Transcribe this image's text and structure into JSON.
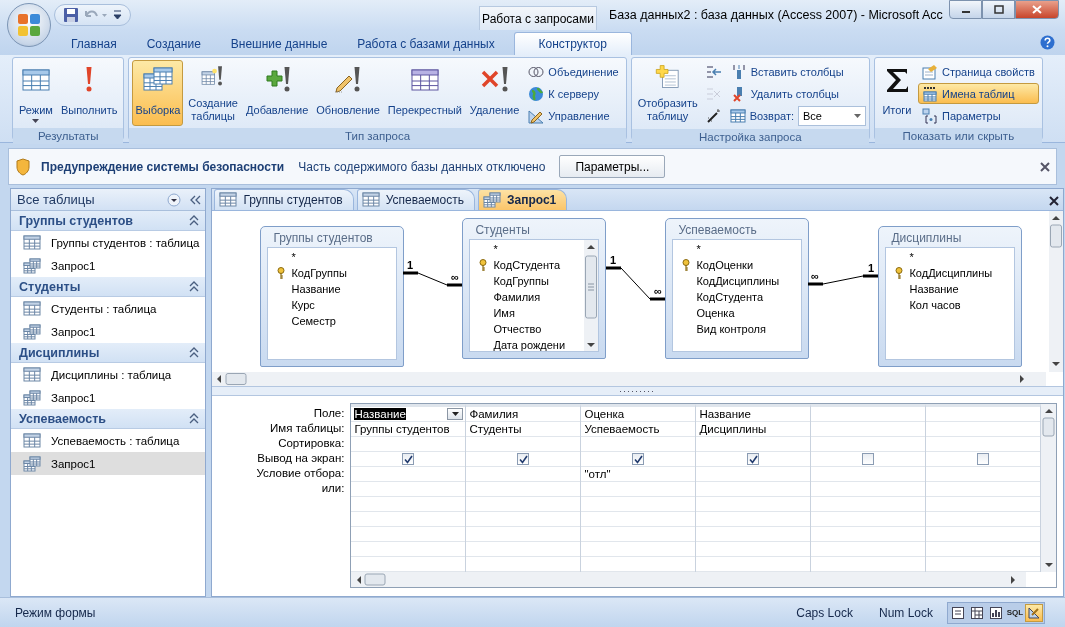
{
  "title_bar": {
    "context_tab": "Работа с запросами",
    "title": "База данных2 : база данных (Access 2007)  -  Microsoft Acc"
  },
  "ribbon_tabs": [
    {
      "label": "Главная",
      "selected": false
    },
    {
      "label": "Создание",
      "selected": false
    },
    {
      "label": "Внешние данные",
      "selected": false
    },
    {
      "label": "Работа с базами данных",
      "selected": false
    },
    {
      "label": "Конструктор",
      "selected": true
    }
  ],
  "ribbon_groups": [
    {
      "title": "Результаты",
      "items": [
        {
          "kind": "large",
          "label": "Режим",
          "dropdown": true,
          "selected": false
        },
        {
          "kind": "large",
          "label": "Выполнить",
          "dropdown": false,
          "selected": false
        }
      ]
    },
    {
      "title": "Тип запроса",
      "items": [
        {
          "kind": "large",
          "label": "Выборка",
          "dropdown": false,
          "selected": true
        },
        {
          "kind": "large",
          "label": "Создание таблицы",
          "dropdown": false,
          "selected": false
        },
        {
          "kind": "large",
          "label": "Добавление",
          "dropdown": false,
          "selected": false
        },
        {
          "kind": "large",
          "label": "Обновление",
          "dropdown": false,
          "selected": false
        },
        {
          "kind": "large",
          "label": "Перекрестный",
          "dropdown": false,
          "selected": false
        },
        {
          "kind": "large",
          "label": "Удаление",
          "dropdown": false,
          "selected": false
        },
        {
          "kind": "stack",
          "items": [
            {
              "kind": "small",
              "label": "Объединение",
              "selected": false
            },
            {
              "kind": "small",
              "label": "К серверу",
              "selected": false
            },
            {
              "kind": "small",
              "label": "Управление",
              "selected": false
            }
          ]
        }
      ]
    },
    {
      "title": "Настройка запроса",
      "items": [
        {
          "kind": "large",
          "label": "Отобразить таблицу",
          "dropdown": false,
          "selected": false
        },
        {
          "kind": "stack",
          "items": [
            {
              "kind": "icon",
              "disabled": false
            },
            {
              "kind": "icon",
              "disabled": true
            },
            {
              "kind": "icon",
              "disabled": false
            }
          ]
        },
        {
          "kind": "stack",
          "items": [
            {
              "kind": "small",
              "label": "Вставить столбцы",
              "selected": false
            },
            {
              "kind": "small",
              "label": "Удалить столбцы",
              "selected": false
            },
            {
              "kind": "combo",
              "label": "Возврат:",
              "value": "Все"
            }
          ]
        }
      ]
    },
    {
      "title": "Показать или скрыть",
      "items": [
        {
          "kind": "large",
          "label": "Итоги",
          "dropdown": false,
          "selected": false
        },
        {
          "kind": "stack",
          "items": [
            {
              "kind": "small",
              "label": "Страница свойств",
              "selected": false
            },
            {
              "kind": "small",
              "label": "Имена таблиц",
              "selected": true
            },
            {
              "kind": "small",
              "label": "Параметры",
              "selected": false
            }
          ]
        }
      ]
    }
  ],
  "security_bar": {
    "title": "Предупреждение системы безопасности",
    "message": "Часть содержимого базы данных отключено",
    "button": "Параметры..."
  },
  "nav_pane": {
    "header": "Все таблицы",
    "groups": [
      {
        "title": "Группы студентов",
        "expanded": true,
        "items": [
          {
            "kind": "table",
            "label": "Группы студентов : таблица",
            "selected": false
          },
          {
            "kind": "query",
            "label": "Запрос1",
            "selected": false
          }
        ]
      },
      {
        "title": "Студенты",
        "expanded": true,
        "items": [
          {
            "kind": "table",
            "label": "Студенты : таблица",
            "selected": false
          },
          {
            "kind": "query",
            "label": "Запрос1",
            "selected": false
          }
        ]
      },
      {
        "title": "Дисциплины",
        "expanded": true,
        "items": [
          {
            "kind": "table",
            "label": "Дисциплины : таблица",
            "selected": false
          },
          {
            "kind": "query",
            "label": "Запрос1",
            "selected": false
          }
        ]
      },
      {
        "title": "Успеваемость",
        "expanded": true,
        "items": [
          {
            "kind": "table",
            "label": "Успеваемость : таблица",
            "selected": false
          },
          {
            "kind": "query",
            "label": "Запрос1",
            "selected": true
          }
        ]
      }
    ]
  },
  "document_tabs": [
    {
      "kind": "table",
      "label": "Группы студентов",
      "selected": false
    },
    {
      "kind": "table",
      "label": "Успеваемость",
      "selected": false
    },
    {
      "kind": "query",
      "label": "Запрос1",
      "selected": true
    }
  ],
  "diagram": {
    "tables": [
      {
        "title": "Группы студентов",
        "fields": [
          {
            "name": "*",
            "key": false
          },
          {
            "name": "КодГруппы",
            "key": true
          },
          {
            "name": "Название",
            "key": false
          },
          {
            "name": "Курс",
            "key": false
          },
          {
            "name": "Семестр",
            "key": false
          }
        ]
      },
      {
        "title": "Студенты",
        "fields": [
          {
            "name": "*",
            "key": false
          },
          {
            "name": "КодСтудента",
            "key": true
          },
          {
            "name": "КодГруппы",
            "key": false
          },
          {
            "name": "Фамилия",
            "key": false
          },
          {
            "name": "Имя",
            "key": false
          },
          {
            "name": "Отчество",
            "key": false
          },
          {
            "name": "Дата рождени",
            "key": false
          }
        ]
      },
      {
        "title": "Успеваемость",
        "fields": [
          {
            "name": "*",
            "key": false
          },
          {
            "name": "КодОценки",
            "key": true
          },
          {
            "name": "КодДисциплины",
            "key": false
          },
          {
            "name": "КодСтудента",
            "key": false
          },
          {
            "name": "Оценка",
            "key": false
          },
          {
            "name": "Вид контроля",
            "key": false
          }
        ]
      },
      {
        "title": "Дисциплины",
        "fields": [
          {
            "name": "*",
            "key": false
          },
          {
            "name": "КодДисциплины",
            "key": true
          },
          {
            "name": "Название",
            "key": false
          },
          {
            "name": "Кол часов",
            "key": false
          }
        ]
      }
    ],
    "relationships": [
      {
        "left_label": "1",
        "right_label": "∞"
      },
      {
        "left_label": "1",
        "right_label": "∞"
      },
      {
        "left_label": "∞",
        "right_label": "1"
      }
    ]
  },
  "grid": {
    "row_labels": [
      "Поле:",
      "Имя таблицы:",
      "Сортировка:",
      "Вывод на экран:",
      "Условие отбора:",
      "или:"
    ],
    "columns": [
      {
        "field": "Название",
        "table": "Группы студентов",
        "show": true,
        "selected": true
      },
      {
        "field": "Фамилия",
        "table": "Студенты",
        "show": true,
        "selected": false
      },
      {
        "field": "Оценка",
        "table": "Успеваемость",
        "show": true,
        "criteria": "\"отл\"",
        "selected": false
      },
      {
        "field": "Название",
        "table": "Дисциплины",
        "show": true,
        "selected": false
      },
      {
        "show": false,
        "selected": false
      },
      {
        "show": false,
        "selected": false
      }
    ]
  },
  "status_bar": {
    "mode": "Режим формы",
    "indicators": [
      "Caps Lock",
      "Num Lock"
    ],
    "view_buttons": [
      {
        "kind": "form",
        "selected": false
      },
      {
        "kind": "pivot",
        "selected": false
      },
      {
        "kind": "chart",
        "selected": false
      },
      {
        "kind": "sql",
        "label": "SQL",
        "selected": false
      },
      {
        "kind": "design",
        "selected": true
      }
    ]
  }
}
